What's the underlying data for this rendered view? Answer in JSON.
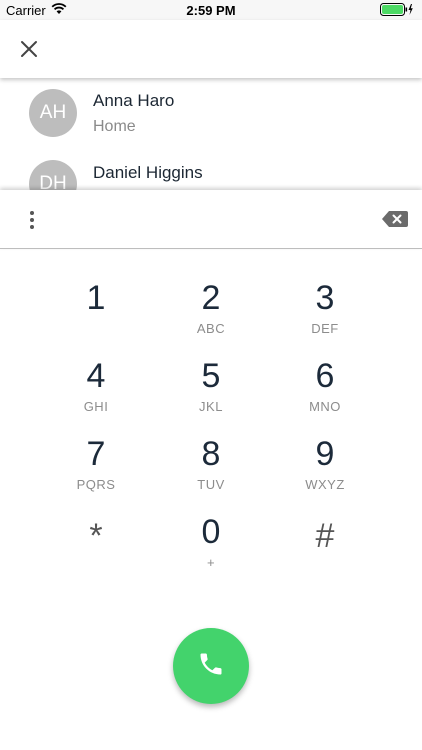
{
  "status_bar": {
    "carrier": "Carrier",
    "time": "2:59 PM"
  },
  "app_bar": {
    "close_icon": "close-icon"
  },
  "contacts": [
    {
      "initials": "AH",
      "name": "Anna Haro",
      "type": "Home"
    },
    {
      "initials": "DH",
      "name": "Daniel Higgins",
      "type": ""
    }
  ],
  "input_bar": {
    "menu_icon": "more-vert-icon",
    "backspace_icon": "backspace-icon"
  },
  "keypad": [
    {
      "digit": "1",
      "letters": ""
    },
    {
      "digit": "2",
      "letters": "ABC"
    },
    {
      "digit": "3",
      "letters": "DEF"
    },
    {
      "digit": "4",
      "letters": "GHI"
    },
    {
      "digit": "5",
      "letters": "JKL"
    },
    {
      "digit": "6",
      "letters": "MNO"
    },
    {
      "digit": "7",
      "letters": "PQRS"
    },
    {
      "digit": "8",
      "letters": "TUV"
    },
    {
      "digit": "9",
      "letters": "WXYZ"
    },
    {
      "digit": "*",
      "letters": ""
    },
    {
      "digit": "0",
      "letters": "+"
    },
    {
      "digit": "#",
      "letters": ""
    }
  ],
  "call_button": {
    "icon": "phone-icon",
    "color": "#43d36c"
  },
  "colors": {
    "avatar": "#bdbdbd",
    "battery": "#4cd964",
    "digit": "#1c2a3a",
    "secondary_text": "#8c8c8c"
  }
}
